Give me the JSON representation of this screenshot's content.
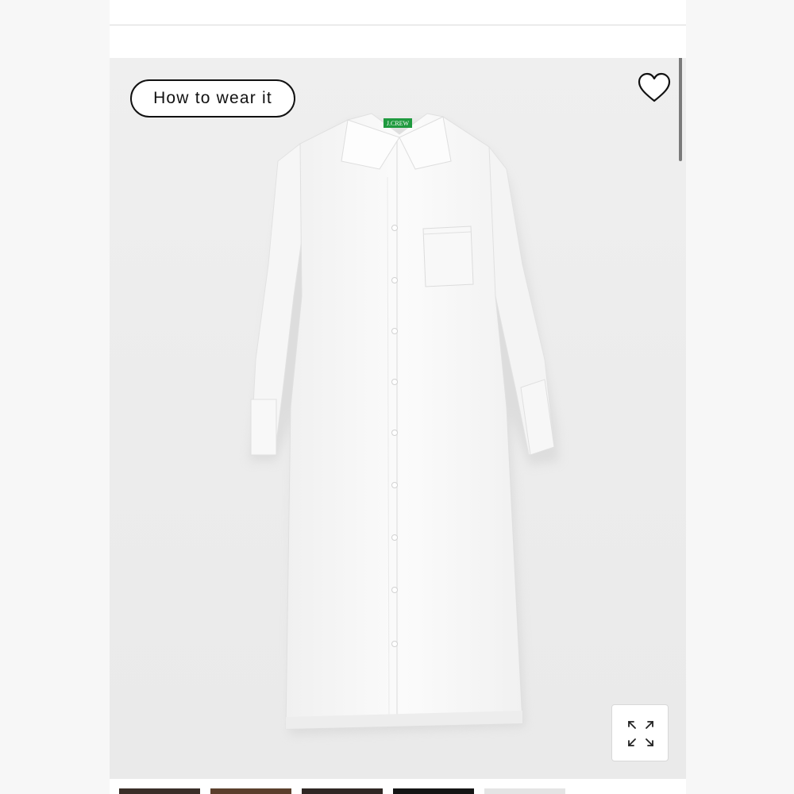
{
  "product_view": {
    "how_to_wear_label": "How to wear it",
    "brand_tag_text": "J.CREW",
    "wishlist_icon": "heart-icon",
    "expand_icon": "expand-arrows-icon"
  },
  "thumbnails": [
    {
      "name": "thumbnail-1",
      "color": "#3a2e28"
    },
    {
      "name": "thumbnail-2",
      "color": "#5b3f2c"
    },
    {
      "name": "thumbnail-3",
      "color": "#2f2724"
    },
    {
      "name": "thumbnail-4",
      "color": "#151515"
    },
    {
      "name": "thumbnail-5",
      "color": "#e4e4e4"
    }
  ],
  "colors": {
    "image_background": "#ececec",
    "brand_tag_green": "#1f9a3f",
    "dress_white": "#fafafa"
  }
}
